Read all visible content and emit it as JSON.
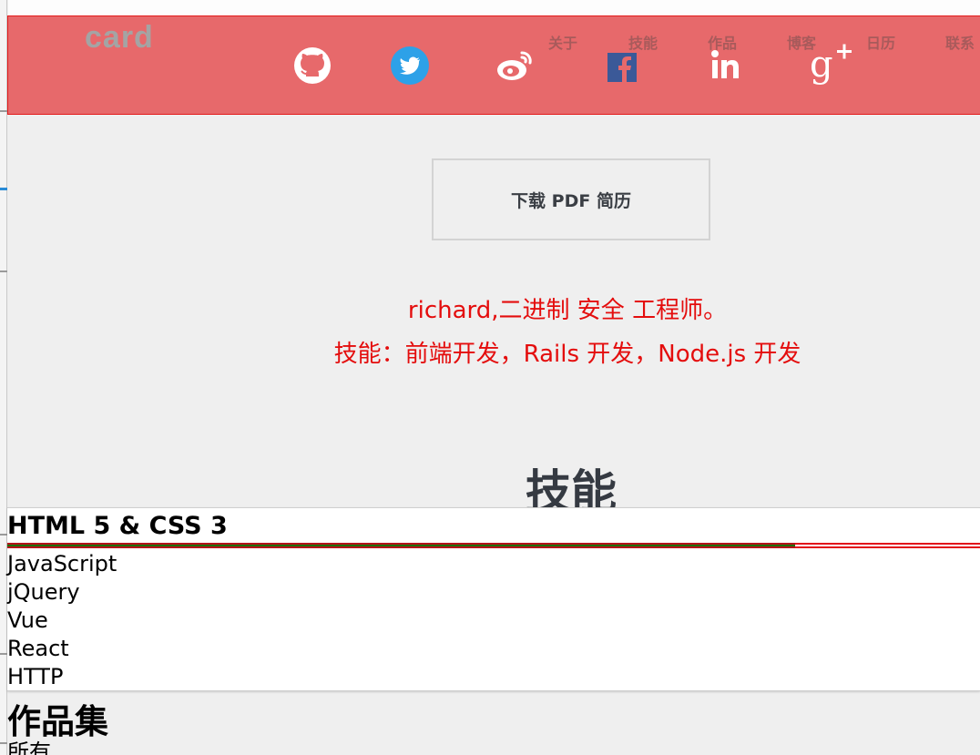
{
  "header": {
    "brand": "card",
    "nav": [
      {
        "label": "关于"
      },
      {
        "label": "技能"
      },
      {
        "label": "作品"
      },
      {
        "label": "博客"
      },
      {
        "label": "日历"
      },
      {
        "label": "联系"
      }
    ],
    "social": [
      {
        "name": "github-icon"
      },
      {
        "name": "twitter-icon"
      },
      {
        "name": "weibo-icon"
      },
      {
        "name": "facebook-icon"
      },
      {
        "name": "linkedin-icon"
      },
      {
        "name": "google-plus-icon"
      }
    ]
  },
  "main": {
    "pdf_button": "下载 PDF 简历",
    "intro_line1": "richard,二进制 安全 工程师。",
    "intro_line2": "技能：前端开发，Rails 开发，Node.js 开发"
  },
  "skills": {
    "heading": "技能",
    "items": [
      {
        "label": "HTML 5 & CSS 3",
        "progress": 0.81
      },
      {
        "label": "JavaScript"
      },
      {
        "label": "jQuery"
      },
      {
        "label": "Vue"
      },
      {
        "label": "React"
      },
      {
        "label": "HTTP"
      }
    ]
  },
  "portfolio": {
    "heading": "作品集",
    "filter_all": "所有"
  },
  "colors": {
    "header_bg": "#e7696b",
    "intro_text": "#e40d0d",
    "bar_fill": "#1f6f0a",
    "bar_track": "#e2101b"
  }
}
